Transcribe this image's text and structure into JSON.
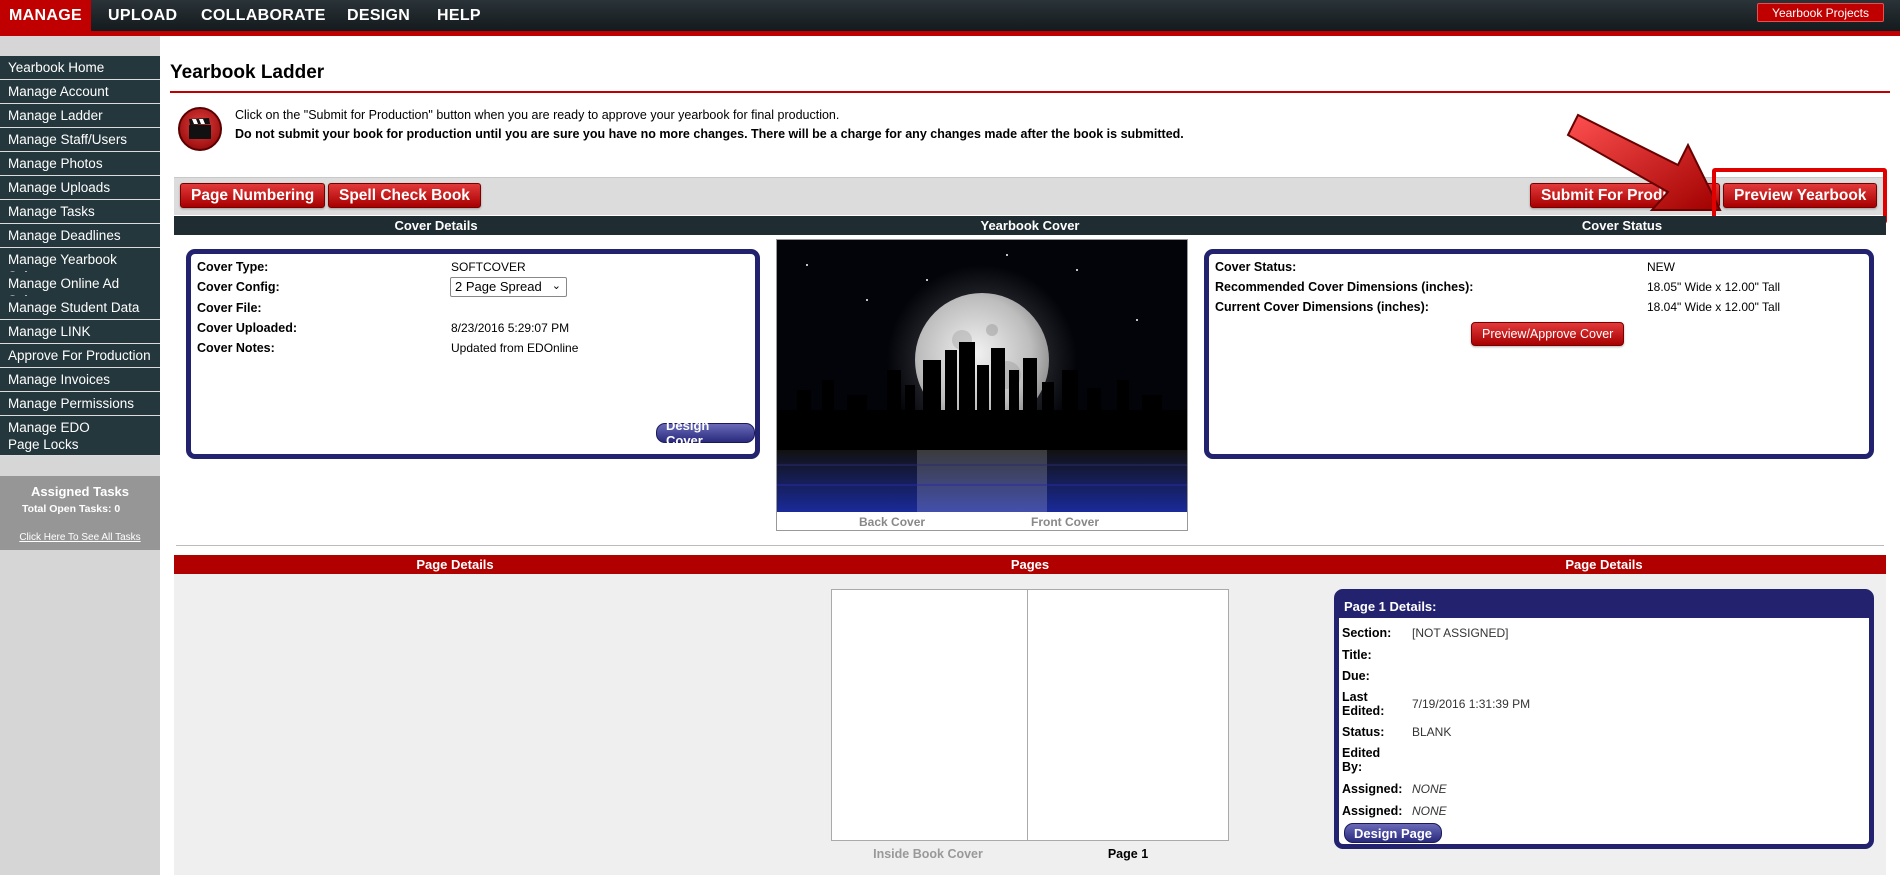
{
  "nav": {
    "items": [
      "MANAGE",
      "UPLOAD",
      "COLLABORATE",
      "DESIGN",
      "HELP"
    ],
    "projects_button": "Yearbook Projects"
  },
  "sidebar": {
    "items": [
      "Yearbook Home",
      "Manage Account",
      "Manage Ladder",
      "Manage Staff/Users",
      "Manage Photos",
      "Manage Uploads",
      "Manage Tasks",
      "Manage Deadlines",
      "Manage Yearbook Sales",
      "Manage Online Ad Sales",
      "Manage Student Data",
      "Manage LINK",
      "Approve For Production",
      "Manage Invoices",
      "Manage Permissions",
      "Manage EDO Page Locks"
    ],
    "tasks": {
      "title": "Assigned Tasks",
      "open": "Total Open Tasks: 0",
      "link": "Click Here To See All Tasks"
    }
  },
  "main": {
    "title": "Yearbook Ladder",
    "notice_line1": "Click on the \"Submit for Production\" button when you are ready to approve your yearbook for final production.",
    "notice_line2": "Do not submit your book for production until you are sure you have no more changes. There will be a charge for any changes made after the book is submitted.",
    "toolbar": {
      "page_numbering": "Page Numbering",
      "spell_check": "Spell Check Book",
      "submit": "Submit For Production",
      "preview": "Preview Yearbook"
    },
    "cover_headers": [
      "Cover Details",
      "Yearbook Cover",
      "Cover Status"
    ],
    "cover_details": {
      "type_label": "Cover Type:",
      "type_value": "SOFTCOVER",
      "config_label": "Cover Config:",
      "config_value": "2 Page Spread",
      "file_label": "Cover File:",
      "uploaded_label": "Cover Uploaded:",
      "uploaded_value": "8/23/2016 5:29:07 PM",
      "notes_label": "Cover Notes:",
      "notes_value": "Updated from EDOnline",
      "design_button": "Design Cover"
    },
    "cover_captions": {
      "back": "Back Cover",
      "front": "Front Cover"
    },
    "cover_status": {
      "status_label": "Cover Status:",
      "status_value": "NEW",
      "rec_label": "Recommended Cover Dimensions (inches):",
      "rec_value": "18.05\" Wide x 12.00\" Tall",
      "cur_label": "Current Cover Dimensions (inches):",
      "cur_value": "18.04\" Wide x 12.00\" Tall",
      "approve_button": "Preview/Approve Cover"
    },
    "pages_headers": [
      "Page Details",
      "Pages",
      "Page Details"
    ],
    "page_captions": {
      "inside": "Inside Book Cover",
      "page1": "Page 1"
    },
    "page_details": {
      "header": "Page 1 Details:",
      "section_label": "Section:",
      "section_value": "[NOT ASSIGNED]",
      "title_label": "Title:",
      "due_label": "Due:",
      "last_label1": "Last",
      "last_label2": "Edited:",
      "last_value": "7/19/2016 1:31:39 PM",
      "status_label": "Status:",
      "status_value": "BLANK",
      "edited_label1": "Edited",
      "edited_label2": "By:",
      "assigned_label": "Assigned:",
      "assigned_value1": "NONE",
      "assigned_value2": "NONE",
      "design_button": "Design Page"
    }
  },
  "colors": {
    "accent_red": "#c00000",
    "nav_dark": "#1f2d33",
    "panel_blue": "#22226e"
  }
}
